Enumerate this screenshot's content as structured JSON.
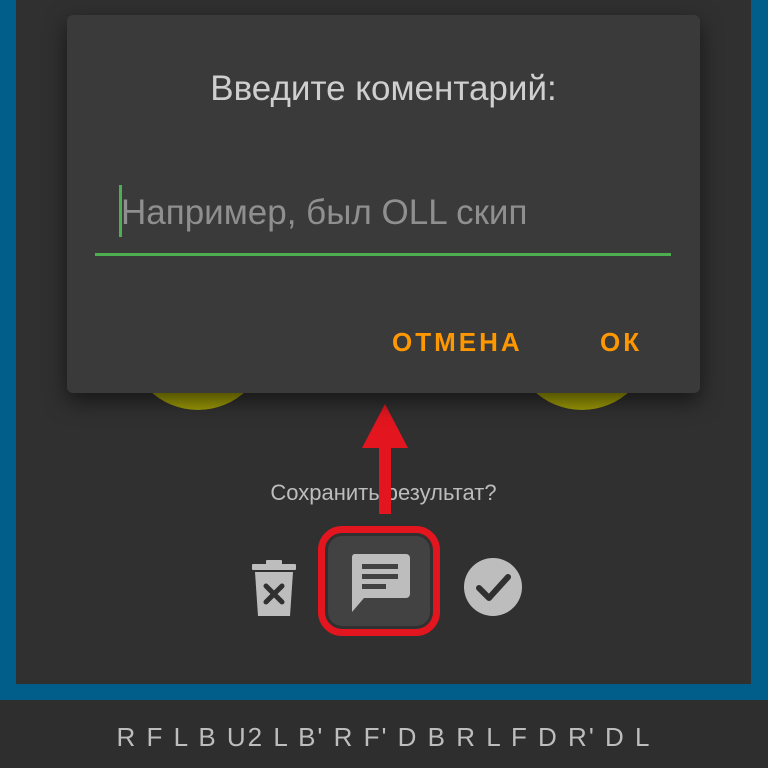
{
  "dialog": {
    "title": "Введите коментарий:",
    "input_placeholder": "Например, был OLL скип",
    "cancel_label": "ОТМЕНА",
    "ok_label": "ОК"
  },
  "save_prompt": "Сохранить результат?",
  "actions": [
    {
      "name": "delete",
      "icon": "trash-icon"
    },
    {
      "name": "comment",
      "icon": "comment-icon"
    },
    {
      "name": "confirm",
      "icon": "check-circle-icon"
    }
  ],
  "scramble": "R F L B U2 L B' R F' D B R L F D R' D L",
  "colors": {
    "accent_orange": "#ff9800",
    "input_line_green": "#4caf50",
    "highlight_red": "#e3161f",
    "frame_blue": "#015d8a"
  }
}
